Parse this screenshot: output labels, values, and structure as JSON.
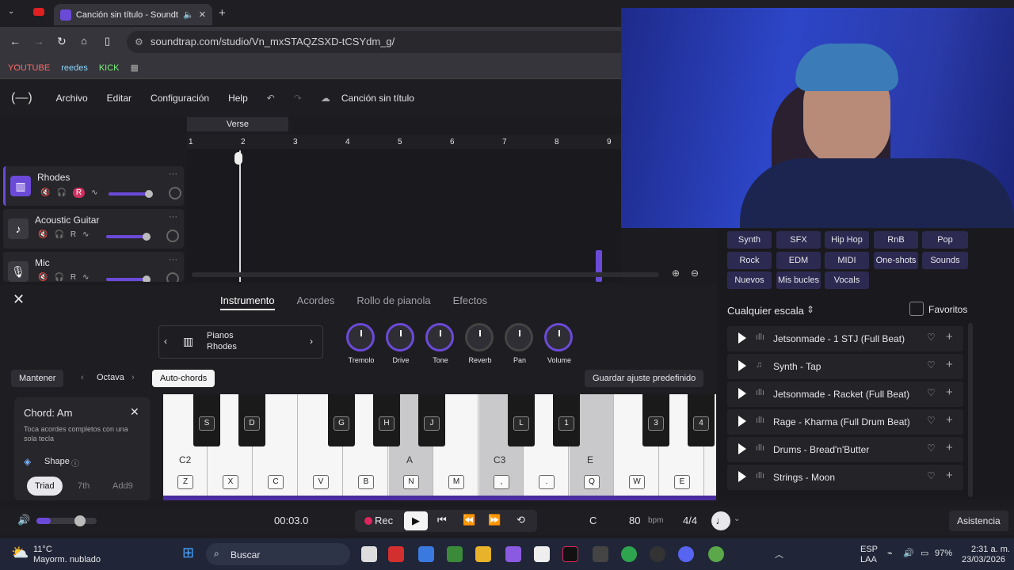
{
  "browser": {
    "tab_title": "Canción sin título - Soundtr",
    "url": "soundtrap.com/studio/Vn_mxSTAQZSXD-tCSYdm_g/",
    "bookmarks": [
      "YOUTUBE",
      "reedes",
      "KICK"
    ]
  },
  "app": {
    "menu": [
      "Archivo",
      "Editar",
      "Configuración",
      "Help"
    ],
    "song_title": "Canción sin título"
  },
  "timeline": {
    "region_label": "Verse",
    "bars": [
      "1",
      "2",
      "3",
      "4",
      "5",
      "6",
      "7",
      "8",
      "9"
    ]
  },
  "tracks": [
    {
      "name": "Rhodes",
      "rec": "R"
    },
    {
      "name": "Acoustic Guitar",
      "rec": "R"
    },
    {
      "name": "Mic",
      "rec": "R"
    }
  ],
  "instrument": {
    "tabs": [
      "Instrumento",
      "Acordes",
      "Rollo de pianola",
      "Efectos"
    ],
    "preset_category": "Pianos",
    "preset_name": "Rhodes",
    "knobs": [
      "Tremolo",
      "Drive",
      "Tone",
      "Reverb",
      "Pan",
      "Volume"
    ],
    "hold_label": "Mantener",
    "octave_label": "Octava",
    "autochords_label": "Auto-chords",
    "save_preset_label": "Guardar ajuste predefinido"
  },
  "chord_card": {
    "title": "Chord: Am",
    "desc": "Toca acordes completos con una sola tecla",
    "shape_label": "Shape",
    "options": [
      "Triad",
      "7th",
      "Add9"
    ]
  },
  "piano": {
    "white_keys": [
      "Z",
      "X",
      "C",
      "V",
      "B",
      "N",
      "M",
      ",",
      ".",
      "Q",
      "W",
      "E"
    ],
    "black_keys": [
      "S",
      "D",
      "G",
      "H",
      "J",
      "L",
      "1",
      "3",
      "4"
    ],
    "note_labels": [
      "C2",
      "A",
      "C3",
      "E"
    ]
  },
  "browser_panel": {
    "tags": [
      "Synth",
      "SFX",
      "Hip Hop",
      "RnB",
      "Pop",
      "Rock",
      "EDM",
      "MIDI",
      "One-shots",
      "Sounds",
      "Nuevos",
      "Mis bucles",
      "Vocals"
    ],
    "scale_label": "Cualquier escala",
    "favorites_label": "Favoritos",
    "loops": [
      "Jetsonmade - 1 STJ (Full Beat)",
      "Synth - Tap",
      "Jetsonmade - Racket (Full Beat)",
      "Rage - Kharma (Full Drum Beat)",
      "Drums - Bread'n'Butter",
      "Strings - Moon"
    ]
  },
  "transport": {
    "time": "00:03.0",
    "rec_label": "Rec",
    "key": "C",
    "bpm": "80",
    "bpm_unit": "bpm",
    "meter": "4/4",
    "assist_label": "Asistencia"
  },
  "taskbar": {
    "weather_temp": "11°C",
    "weather_desc": "Mayorm. nublado",
    "search_label": "Buscar",
    "lang": "ESP",
    "region": "LAA",
    "battery": "97%",
    "time": "2:31 a. m.",
    "date": "23/03/2026"
  }
}
